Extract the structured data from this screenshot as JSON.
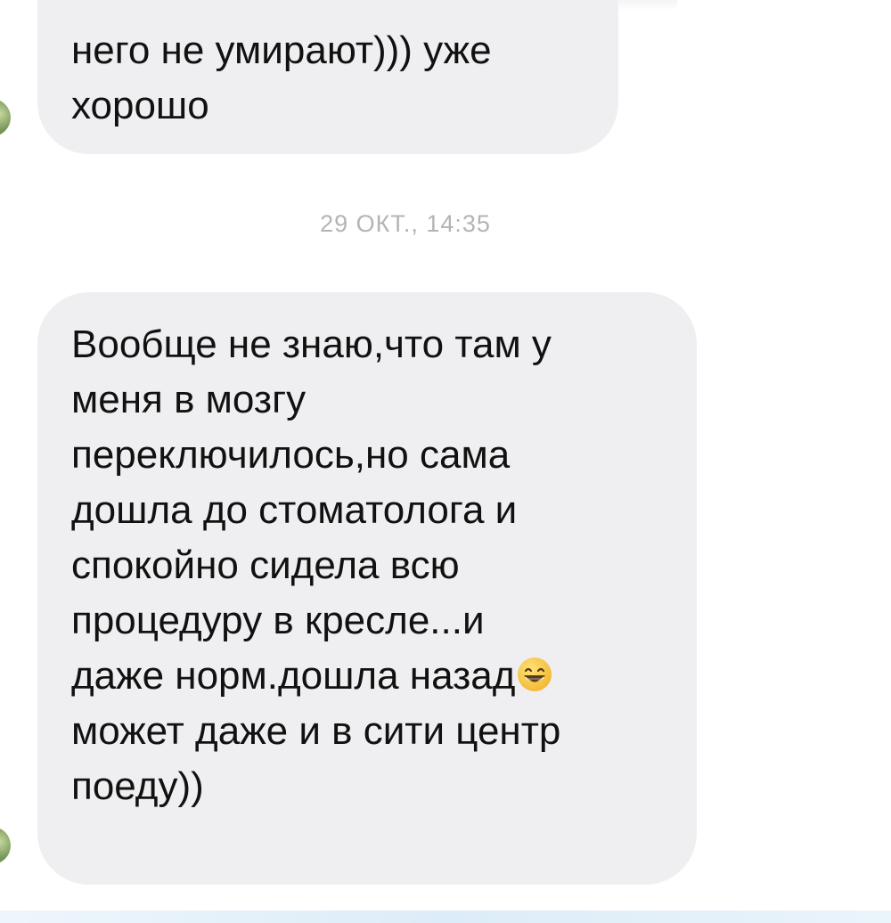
{
  "messages": [
    {
      "text": "него не умирают))) уже\nхорошо"
    },
    {
      "text_before_emoji": "Вообще не знаю,что там у\nменя в мозгу\nпереключилось,но сама\nдошла до стоматолога и\nспокойно сидела всю\nпроцедуру в кресле...и\nдаже норм.дошла назад",
      "emoji": "grinning-face-with-smiling-eyes",
      "text_after_emoji": "\nможет даже и в сити центр\nпоеду))"
    }
  ],
  "timestamp": "29 ОКТ., 14:35",
  "colors": {
    "bubble_background": "#efeff1",
    "message_text": "#111111",
    "timestamp_text": "#b4b4b8",
    "emoji_face": "#f7c844"
  }
}
